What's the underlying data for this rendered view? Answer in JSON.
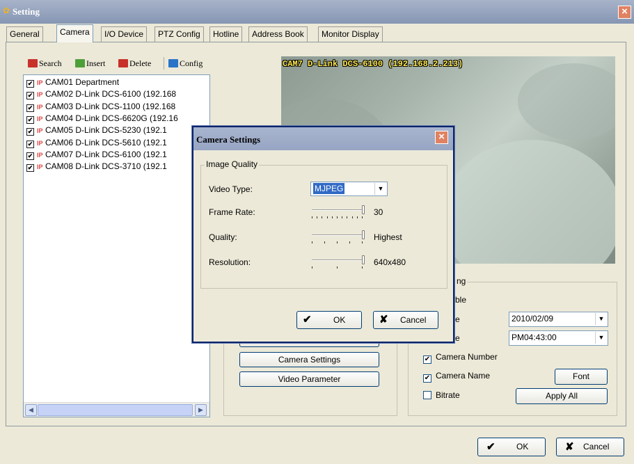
{
  "window": {
    "title": "Setting",
    "close_label": "×"
  },
  "tabs": [
    {
      "label": "General"
    },
    {
      "label": "Camera"
    },
    {
      "label": "I/O Device"
    },
    {
      "label": "PTZ Config"
    },
    {
      "label": "Hotline"
    },
    {
      "label": "Address Book"
    },
    {
      "label": "Monitor Display"
    }
  ],
  "toolbar": {
    "search": "Search",
    "insert": "Insert",
    "delete": "Delete",
    "config": "Config"
  },
  "cameras": [
    {
      "label": "CAM01 Department",
      "checked": true
    },
    {
      "label": "CAM02 D-Link DCS-6100 (192.168",
      "checked": true
    },
    {
      "label": "CAM03 D-Link DCS-1100 (192.168",
      "checked": true
    },
    {
      "label": "CAM04 D-Link DCS-6620G (192.16",
      "checked": true
    },
    {
      "label": "CAM05 D-Link DCS-5230 (192.1",
      "checked": true
    },
    {
      "label": "CAM06 D-Link DCS-5610 (192.1",
      "checked": true
    },
    {
      "label": "CAM07 D-Link DCS-6100 (192.1",
      "checked": true
    },
    {
      "label": "CAM08 D-Link DCS-3710 (192.1",
      "checked": true
    }
  ],
  "preview": {
    "camera_label": "CAM7 D-Link DCS-6100 (192.168.2.213)"
  },
  "buttons": {
    "camera_settings": "Camera Settings",
    "video_parameter": "Video Parameter"
  },
  "osd": {
    "group_title_partial": "ng",
    "enable_partial": "ble",
    "date_partial": "e",
    "time_partial": "e",
    "date_value": "2010/02/09",
    "time_value": "PM04:43:00",
    "camera_number": "Camera Number",
    "camera_name": "Camera Name",
    "bitrate": "Bitrate",
    "font_button": "Font",
    "apply_all_button": "Apply All"
  },
  "dialog": {
    "title": "Camera Settings",
    "group_title": "Image Quality",
    "video_type_label": "Video Type:",
    "video_type_value": "MJPEG",
    "frame_rate_label": "Frame Rate:",
    "frame_rate_value": "30",
    "quality_label": "Quality:",
    "quality_value": "Highest",
    "resolution_label": "Resolution:",
    "resolution_value": "640x480",
    "ok": "OK",
    "cancel": "Cancel",
    "close_label": "×"
  },
  "footer": {
    "ok": "OK",
    "cancel": "Cancel"
  },
  "colors": {
    "selection": "#316ac5",
    "preview_label": "#ffe94c",
    "close_button": "#e08262"
  }
}
